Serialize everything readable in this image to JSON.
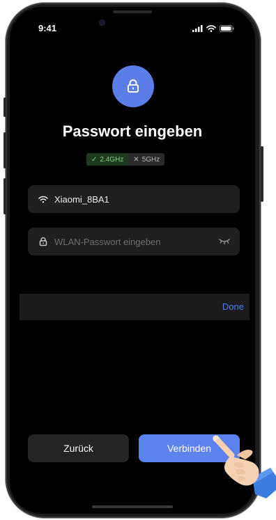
{
  "status_bar": {
    "time": "9:41"
  },
  "header": {
    "title": "Passwort eingeben"
  },
  "bands": [
    {
      "label": "2.4GHz",
      "state": "supported",
      "icon": "check-icon"
    },
    {
      "label": "5GHz",
      "state": "unsupported",
      "icon": "cross-icon"
    }
  ],
  "network": {
    "ssid": "Xiaomi_8BA1",
    "icon": "wifi-icon"
  },
  "password": {
    "placeholder": "WLAN-Passwort eingeben",
    "value": "",
    "icon": "lock-icon"
  },
  "keyboard_toolbar": {
    "done_label": "Done"
  },
  "actions": {
    "back_label": "Zurück",
    "connect_label": "Verbinden"
  },
  "colors": {
    "accent": "#5c82ee",
    "band_ok": "#7ed07e",
    "link": "#4e7ef0"
  }
}
